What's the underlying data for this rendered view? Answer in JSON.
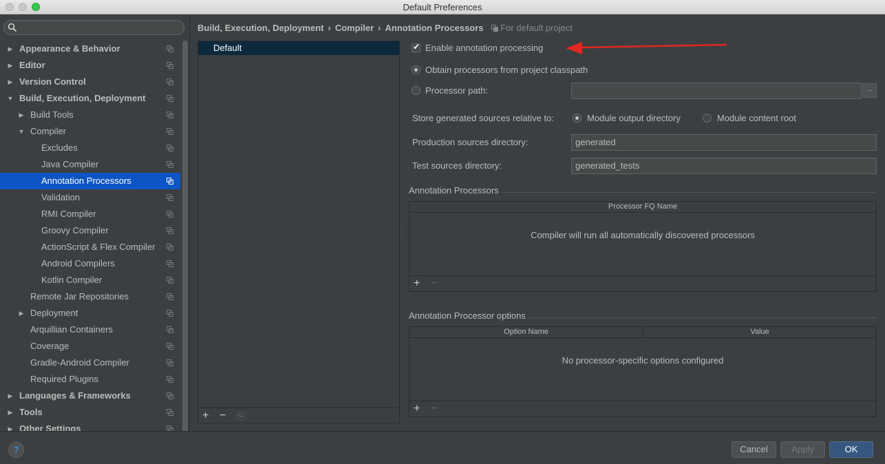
{
  "window": {
    "title": "Default Preferences"
  },
  "search": {
    "placeholder": ""
  },
  "sidebar": {
    "items": [
      {
        "label": "Appearance & Behavior",
        "level": 0,
        "arrow": "▶",
        "bold": true
      },
      {
        "label": "Editor",
        "level": 0,
        "arrow": "▶",
        "bold": true
      },
      {
        "label": "Version Control",
        "level": 0,
        "arrow": "▶",
        "bold": true
      },
      {
        "label": "Build, Execution, Deployment",
        "level": 0,
        "arrow": "▼",
        "bold": true
      },
      {
        "label": "Build Tools",
        "level": 1,
        "arrow": "▶",
        "bold": false
      },
      {
        "label": "Compiler",
        "level": 1,
        "arrow": "▼",
        "bold": false
      },
      {
        "label": "Excludes",
        "level": 2,
        "arrow": "",
        "bold": false
      },
      {
        "label": "Java Compiler",
        "level": 2,
        "arrow": "",
        "bold": false
      },
      {
        "label": "Annotation Processors",
        "level": 2,
        "arrow": "",
        "bold": false,
        "selected": true
      },
      {
        "label": "Validation",
        "level": 2,
        "arrow": "",
        "bold": false
      },
      {
        "label": "RMI Compiler",
        "level": 2,
        "arrow": "",
        "bold": false
      },
      {
        "label": "Groovy Compiler",
        "level": 2,
        "arrow": "",
        "bold": false
      },
      {
        "label": "ActionScript & Flex Compiler",
        "level": 2,
        "arrow": "",
        "bold": false
      },
      {
        "label": "Android Compilers",
        "level": 2,
        "arrow": "",
        "bold": false
      },
      {
        "label": "Kotlin Compiler",
        "level": 2,
        "arrow": "",
        "bold": false
      },
      {
        "label": "Remote Jar Repositories",
        "level": 1,
        "arrow": "",
        "bold": false
      },
      {
        "label": "Deployment",
        "level": 1,
        "arrow": "▶",
        "bold": false
      },
      {
        "label": "Arquillian Containers",
        "level": 1,
        "arrow": "",
        "bold": false
      },
      {
        "label": "Coverage",
        "level": 1,
        "arrow": "",
        "bold": false
      },
      {
        "label": "Gradle-Android Compiler",
        "level": 1,
        "arrow": "",
        "bold": false
      },
      {
        "label": "Required Plugins",
        "level": 1,
        "arrow": "",
        "bold": false
      },
      {
        "label": "Languages & Frameworks",
        "level": 0,
        "arrow": "▶",
        "bold": true
      },
      {
        "label": "Tools",
        "level": 0,
        "arrow": "▶",
        "bold": true
      },
      {
        "label": "Other Settings",
        "level": 0,
        "arrow": "▶",
        "bold": true
      }
    ]
  },
  "breadcrumb": {
    "parts": [
      "Build, Execution, Deployment",
      "Compiler",
      "Annotation Processors"
    ],
    "separator": "›",
    "hint": "For default project"
  },
  "profiles": {
    "items": [
      "Default"
    ],
    "toolbar": {
      "add": "+",
      "remove": "−",
      "copy": "⎘"
    }
  },
  "form": {
    "enable_processing": {
      "label": "Enable annotation processing",
      "checked": true
    },
    "obtain_classpath": {
      "label": "Obtain processors from project classpath",
      "selected": true
    },
    "processor_path": {
      "label": "Processor path:",
      "value": "",
      "browse": "..."
    },
    "store_relative": {
      "label": "Store generated sources relative to:",
      "options": [
        {
          "label": "Module output directory",
          "selected": true
        },
        {
          "label": "Module content root",
          "selected": false
        }
      ]
    },
    "production_dir": {
      "label": "Production sources directory:",
      "value": "generated"
    },
    "test_dir": {
      "label": "Test sources directory:",
      "value": "generated_tests"
    }
  },
  "processors_section": {
    "title": "Annotation Processors",
    "columns": [
      "Processor FQ Name"
    ],
    "empty_text": "Compiler will run all automatically discovered processors",
    "toolbar": {
      "add": "+",
      "remove": "−"
    }
  },
  "options_section": {
    "title": "Annotation Processor options",
    "columns": [
      "Option Name",
      "Value"
    ],
    "empty_text": "No processor-specific options configured",
    "toolbar": {
      "add": "+",
      "remove": "−"
    }
  },
  "buttons": {
    "help": "?",
    "cancel": "Cancel",
    "apply": "Apply",
    "ok": "OK"
  },
  "colors": {
    "selection": "#0d55c4",
    "annotation_arrow": "#e0281e",
    "primary_button": "#365880"
  }
}
